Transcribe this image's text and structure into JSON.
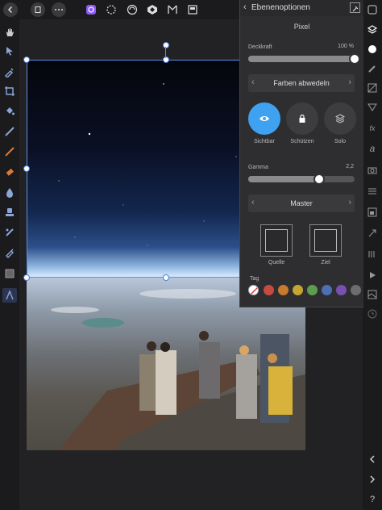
{
  "panel": {
    "title": "Ebenenoptionen",
    "subtitle": "Pixel",
    "opacity_label": "Deckkraft",
    "opacity_value": "100 %",
    "blend_mode": "Farben abwedeln",
    "visibility_buttons": [
      "Sichtbar",
      "Schützen",
      "Solo"
    ],
    "gamma_label": "Gamma",
    "gamma_value": "2,2",
    "channel": "Master",
    "source_label": "Quelle",
    "target_label": "Ziel",
    "tag_label": "Tag",
    "tag_colors": [
      "#c64a3f",
      "#c67a2e",
      "#c4a533",
      "#5e9d4e",
      "#4d6fb4",
      "#7a4fb0",
      "#6d6d70"
    ],
    "opacity_fraction": 1.0,
    "gamma_fraction": 0.67
  },
  "colors": {
    "accent": "#4aa3f0"
  }
}
